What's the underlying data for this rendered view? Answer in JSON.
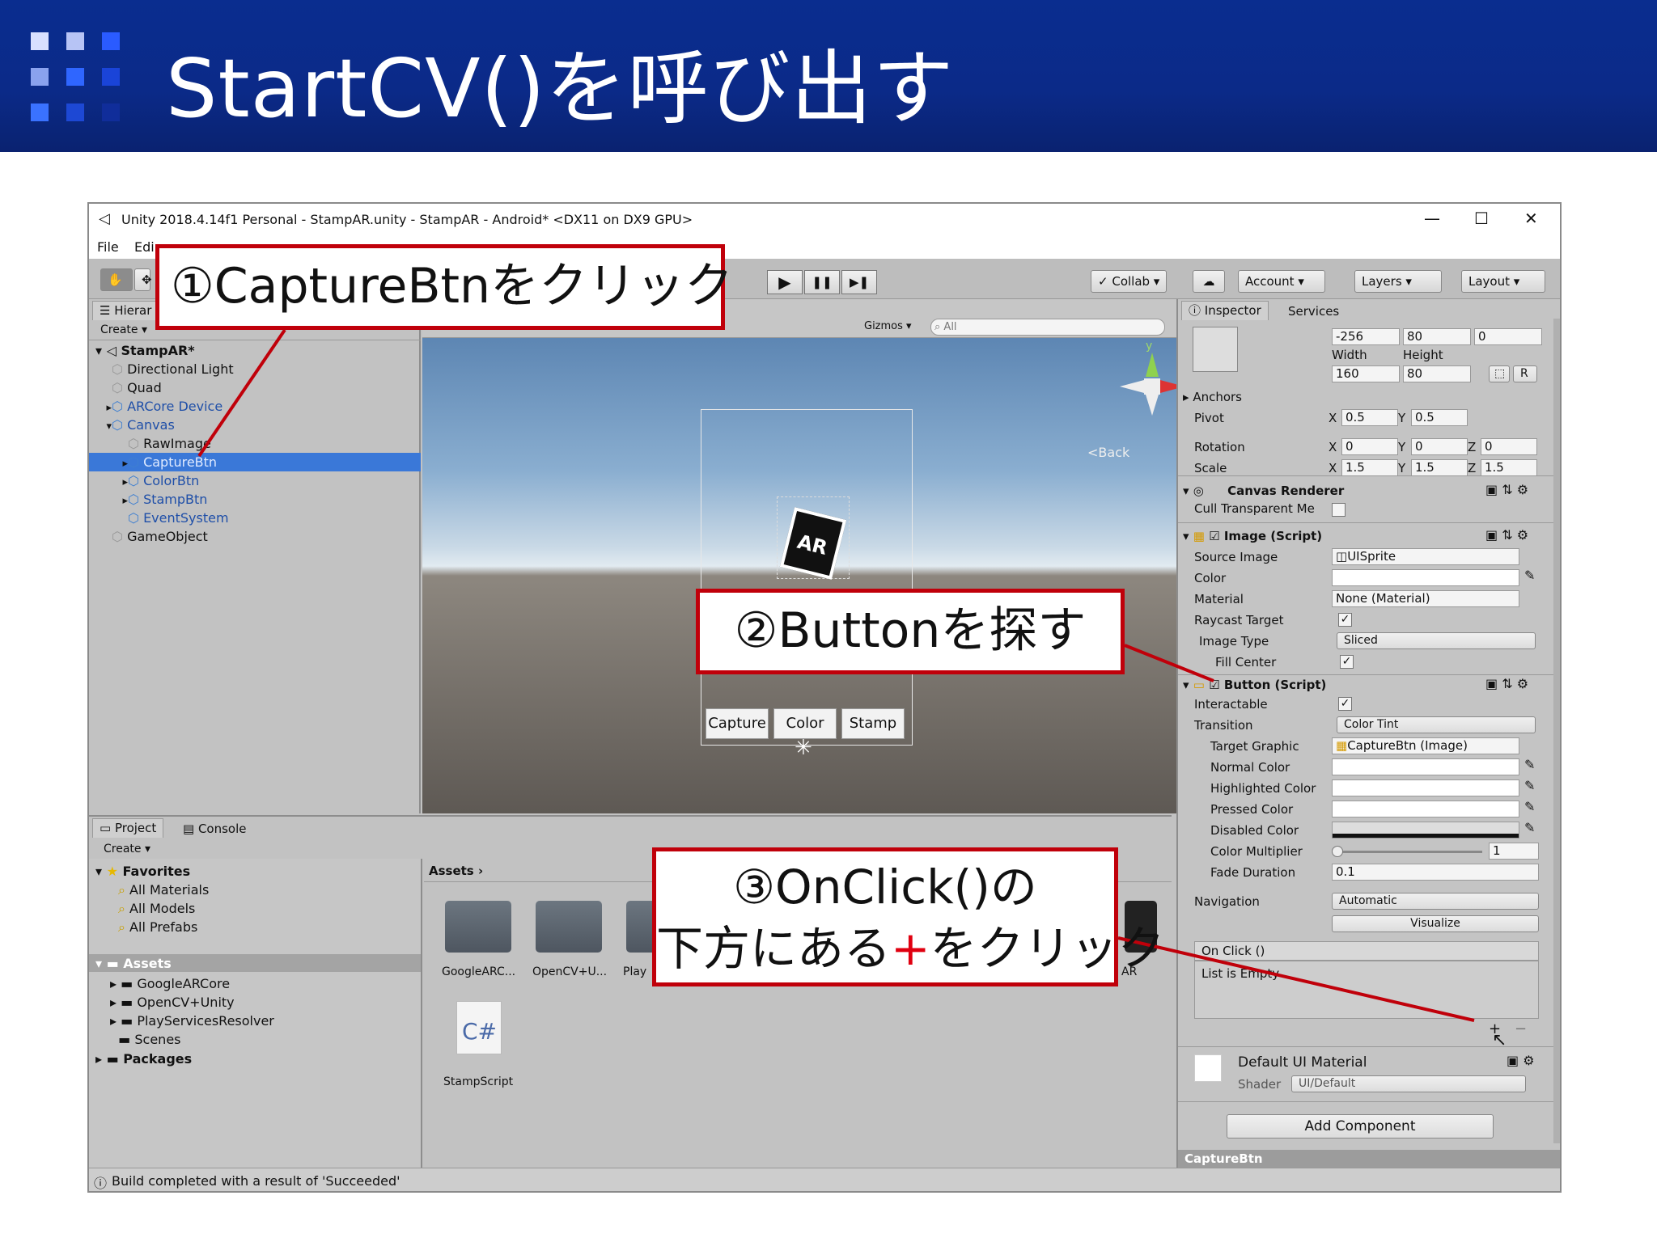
{
  "slide": {
    "title": "StartCV()を呼び出す",
    "accent_color": "#0b2a88",
    "callout_color": "#c0000a"
  },
  "callouts": {
    "c1": "①CaptureBtnをクリック",
    "c2": "②Buttonを探す",
    "c3_line1": "③OnClick()の",
    "c3_line2_a": "下方にある",
    "c3_line2_plus": "+",
    "c3_line2_b": "をクリック"
  },
  "window": {
    "title": "Unity 2018.4.14f1 Personal - StampAR.unity - StampAR - Android* <DX11 on DX9 GPU>",
    "menu": [
      "File",
      "Edi"
    ],
    "controls": {
      "minimize": "—",
      "maximize": "☐",
      "close": "✕"
    }
  },
  "toolbar": {
    "play": "▶",
    "pause": "❚❚",
    "step": "▶❚",
    "collab": "Collab ▾",
    "cloud": "☁",
    "account": "Account ▾",
    "layers": "Layers ▾",
    "layout": "Layout ▾"
  },
  "hierarchy": {
    "tab": "Hierar",
    "create": "Create ▾",
    "scene": "StampAR*",
    "items": [
      {
        "label": "Directional Light",
        "indent": 1,
        "blue": false
      },
      {
        "label": "Quad",
        "indent": 1,
        "blue": false
      },
      {
        "label": "ARCore Device",
        "indent": 1,
        "blue": true
      },
      {
        "label": "Canvas",
        "indent": 1,
        "blue": true
      },
      {
        "label": "RawImage",
        "indent": 2,
        "blue": false
      },
      {
        "label": "CaptureBtn",
        "indent": 2,
        "blue": true
      },
      {
        "label": "ColorBtn",
        "indent": 2,
        "blue": true
      },
      {
        "label": "StampBtn",
        "indent": 2,
        "blue": true
      },
      {
        "label": "EventSystem",
        "indent": 2,
        "blue": true
      },
      {
        "label": "GameObject",
        "indent": 1,
        "blue": false
      }
    ]
  },
  "scene_view": {
    "gizmos": "Gizmos ▾",
    "search_placeholder": "All",
    "axis_y": "y",
    "back_label": "Back",
    "marker_text": "AR",
    "buttons": [
      "Capture",
      "Color",
      "Stamp"
    ]
  },
  "project": {
    "tab_project": "Project",
    "tab_console": "Console",
    "create": "Create ▾",
    "favorites_header": "Favorites",
    "favorites": [
      "All Materials",
      "All Models",
      "All Prefabs"
    ],
    "assets_header": "Assets",
    "assets": [
      "GoogleARCore",
      "OpenCV+Unity",
      "PlayServicesResolver",
      "Scenes"
    ],
    "packages": "Packages",
    "breadcrumb": "Assets",
    "grid": [
      {
        "label": "GoogleARC..."
      },
      {
        "label": "OpenCV+U..."
      },
      {
        "label": "Play"
      },
      {
        "label": "AR"
      }
    ],
    "script_icon": "C#",
    "script_label": "StampScript"
  },
  "status": {
    "message": "Build completed with a result of 'Succeeded'"
  },
  "inspector": {
    "tab_inspector": "Inspector",
    "tab_services": "Services",
    "rect": {
      "pos_x": "-256",
      "pos_y": "80",
      "pos_z": "0",
      "width_label": "Width",
      "height_label": "Height",
      "width": "160",
      "height": "80",
      "r_button": "R",
      "anchors": "Anchors",
      "pivot_label": "Pivot",
      "pivot_x": "0.5",
      "pivot_y": "0.5",
      "rotation_label": "Rotation",
      "rot_x": "0",
      "rot_y": "0",
      "rot_z": "0",
      "scale_label": "Scale",
      "scale_x": "1.5",
      "scale_y": "1.5",
      "scale_z": "1.5",
      "x": "X",
      "y": "Y",
      "z": "Z"
    },
    "canvas_renderer": {
      "title": "Canvas Renderer",
      "cull_label": "Cull Transparent Me"
    },
    "image": {
      "title": "Image (Script)",
      "source_label": "Source Image",
      "source_value": "UISprite",
      "color_label": "Color",
      "material_label": "Material",
      "material_value": "None (Material)",
      "raycast_label": "Raycast Target",
      "type_label": "Image Type",
      "type_value": "Sliced",
      "fill_label": "Fill Center"
    },
    "button": {
      "title": "Button (Script)",
      "interactable_label": "Interactable",
      "transition_label": "Transition",
      "transition_value": "Color Tint",
      "target_label": "Target Graphic",
      "target_value": "CaptureBtn (Image)",
      "normal_label": "Normal Color",
      "highlighted_label": "Highlighted Color",
      "pressed_label": "Pressed Color",
      "disabled_label": "Disabled Color",
      "multiplier_label": "Color Multiplier",
      "multiplier_value": "1",
      "fade_label": "Fade Duration",
      "fade_value": "0.1",
      "navigation_label": "Navigation",
      "navigation_value": "Automatic",
      "visualize": "Visualize",
      "onclick_header": "On Click ()",
      "onclick_empty": "List is Empty",
      "plus": "+",
      "minus": "−"
    },
    "material": {
      "name": "Default UI Material",
      "shader_label": "Shader",
      "shader_value": "UI/Default"
    },
    "add_component": "Add Component",
    "footer": "CaptureBtn"
  }
}
